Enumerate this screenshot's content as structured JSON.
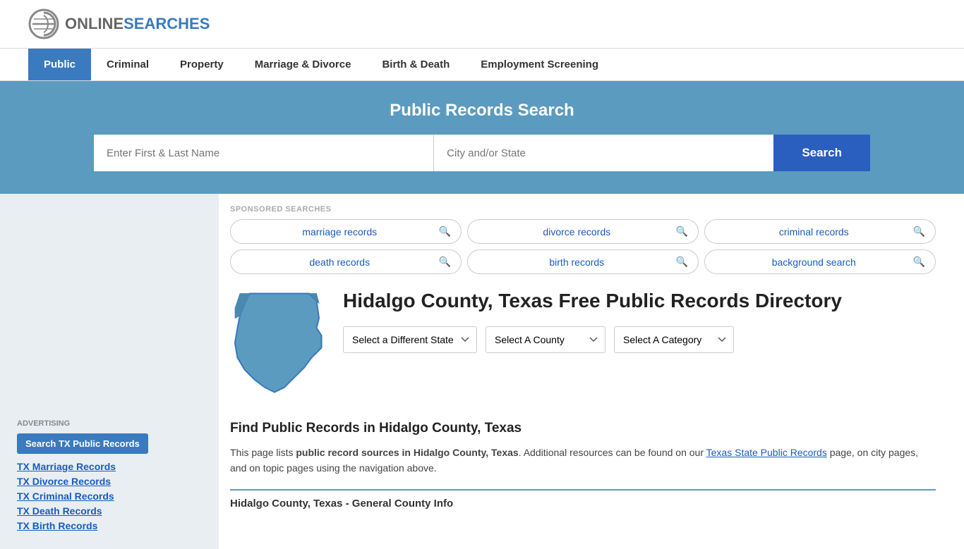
{
  "header": {
    "logo_online": "ONLINE",
    "logo_searches": "SEARCHES"
  },
  "nav": {
    "items": [
      {
        "label": "Public",
        "active": true
      },
      {
        "label": "Criminal",
        "active": false
      },
      {
        "label": "Property",
        "active": false
      },
      {
        "label": "Marriage & Divorce",
        "active": false
      },
      {
        "label": "Birth & Death",
        "active": false
      },
      {
        "label": "Employment Screening",
        "active": false
      }
    ]
  },
  "hero": {
    "title": "Public Records Search",
    "name_placeholder": "Enter First & Last Name",
    "location_placeholder": "City and/or State",
    "search_button": "Search"
  },
  "sponsored": {
    "label": "SPONSORED SEARCHES",
    "pills": [
      {
        "label": "marriage records"
      },
      {
        "label": "divorce records"
      },
      {
        "label": "criminal records"
      },
      {
        "label": "death records"
      },
      {
        "label": "birth records"
      },
      {
        "label": "background search"
      }
    ]
  },
  "county": {
    "title": "Hidalgo County, Texas Free Public Records Directory"
  },
  "dropdowns": {
    "state": "Select a Different State",
    "county": "Select A County",
    "category": "Select A Category"
  },
  "find_section": {
    "title": "Find Public Records in Hidalgo County, Texas",
    "description_pre": "This page lists ",
    "description_bold": "public record sources in Hidalgo County, Texas",
    "description_mid": ". Additional resources can be found on our ",
    "link_text": "Texas State Public Records",
    "description_post": " page, on city pages, and on topic pages using the navigation above."
  },
  "general_info": {
    "title": "Hidalgo County, Texas - General County Info"
  },
  "sidebar": {
    "ad_label": "Advertising",
    "ad_button": "Search TX Public Records",
    "links": [
      {
        "label": "TX Marriage Records"
      },
      {
        "label": "TX Divorce Records"
      },
      {
        "label": "TX Criminal Records"
      },
      {
        "label": "TX Death Records"
      },
      {
        "label": "TX Birth Records"
      }
    ]
  }
}
